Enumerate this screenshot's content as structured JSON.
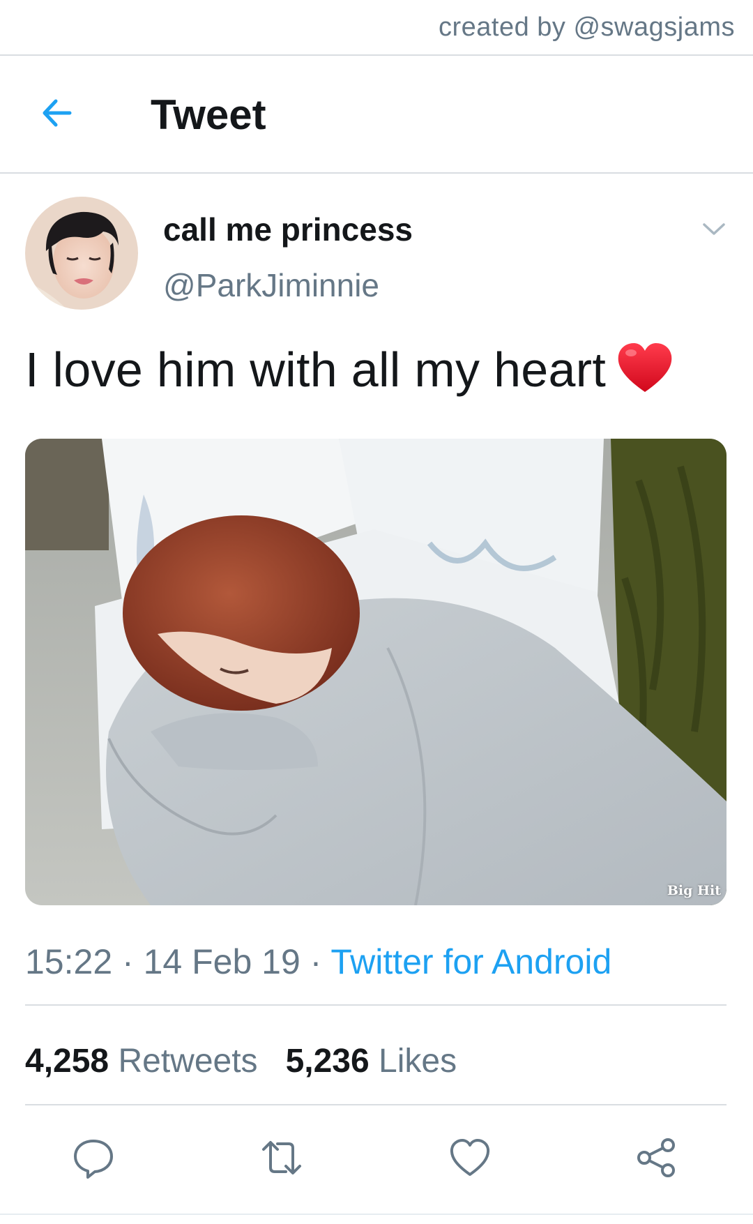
{
  "watermark": {
    "text": "created by @swagsjams"
  },
  "header": {
    "title": "Tweet",
    "back_icon": "arrow-left-icon"
  },
  "tweet": {
    "display_name": "call me princess",
    "handle": "@ParkJiminnie",
    "text": "I love him with all my heart",
    "emoji": "red-heart-emoji",
    "media_credit": "Big Hit",
    "time": "15:22",
    "date": "14 Feb 19",
    "separator": "·",
    "source": "Twitter for Android"
  },
  "stats": {
    "retweets_count": "4,258",
    "retweets_label": "Retweets",
    "likes_count": "5,236",
    "likes_label": "Likes"
  },
  "actions": {
    "reply_icon": "reply-icon",
    "retweet_icon": "retweet-icon",
    "like_icon": "heart-icon",
    "share_icon": "share-icon"
  },
  "colors": {
    "accent": "#1da1f2",
    "secondary_text": "#657786",
    "primary_text": "#14171a",
    "divider": "#d9dde1",
    "heart": "#e0142c"
  }
}
